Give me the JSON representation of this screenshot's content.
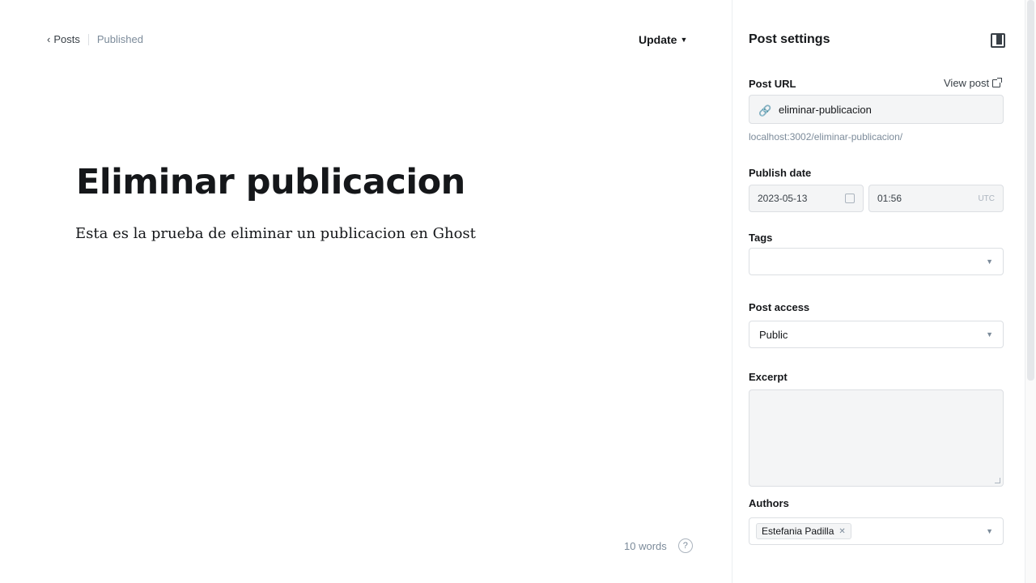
{
  "editor": {
    "back_label": "Posts",
    "status": "Published",
    "update_label": "Update",
    "title": "Eliminar publicacion",
    "body": "Esta es la prueba de eliminar un publicacion en Ghost",
    "word_count": "10 words",
    "help_glyph": "?"
  },
  "settings": {
    "title": "Post settings",
    "url_label": "Post URL",
    "view_post_label": "View post",
    "slug": "eliminar-publicacion",
    "url_preview": "localhost:3002/eliminar-publicacion/",
    "publish_date_label": "Publish date",
    "date_value": "2023-05-13",
    "time_value": "01:56",
    "timezone": "UTC",
    "tags_label": "Tags",
    "access_label": "Post access",
    "access_value": "Public",
    "excerpt_label": "Excerpt",
    "authors_label": "Authors",
    "author_name": "Estefania Padilla"
  },
  "colors": {
    "accent": "#15171a",
    "muted": "#7c8b9a",
    "border": "#dcdfe3"
  }
}
